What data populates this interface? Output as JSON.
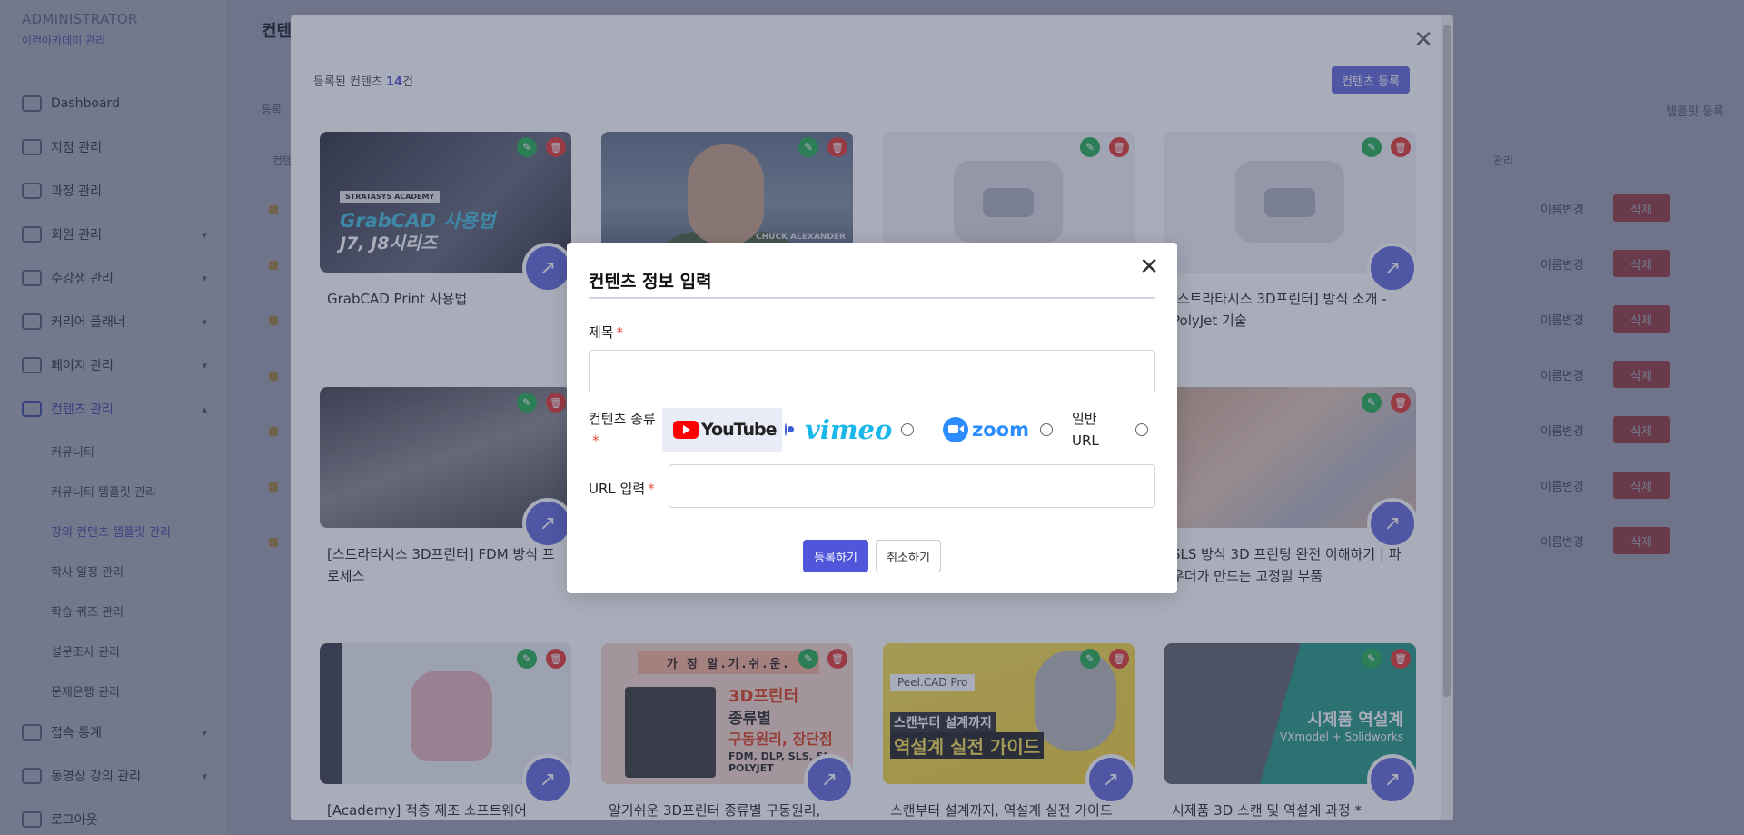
{
  "sidebar": {
    "admin_title": "ADMINISTRATOR",
    "admin_sub": "이런아카데미 관리",
    "items": [
      {
        "label": "Dashboard",
        "chevron": ""
      },
      {
        "label": "지점 관리",
        "chevron": ""
      },
      {
        "label": "과정 관리",
        "chevron": ""
      },
      {
        "label": "회원 관리",
        "chevron": "▾"
      },
      {
        "label": "수강생 관리",
        "chevron": "▾"
      },
      {
        "label": "커리어 플래너",
        "chevron": "▾"
      },
      {
        "label": "페이지 관리",
        "chevron": "▾"
      },
      {
        "label": "컨텐츠 관리",
        "chevron": "▴"
      }
    ],
    "sub_items": [
      "커뮤니티",
      "커뮤니티 템플릿 관리",
      "강의 컨텐츠 템플릿 관리",
      "학사 일정 관리",
      "학습 퀴즈 관리",
      "설문조사 관리",
      "문제은행 관리"
    ],
    "bottom_items": [
      {
        "label": "접속 통계",
        "chevron": "▾"
      },
      {
        "label": "동영상 강의 관리",
        "chevron": "▾"
      },
      {
        "label": "로그아웃",
        "chevron": ""
      }
    ]
  },
  "main": {
    "page_title": "컨텐",
    "small_left": "등록",
    "col_left": "컨텐",
    "template_register": "템플릿 등록",
    "col_manage": "관리",
    "row_rename": "이름변경",
    "row_delete": "삭제"
  },
  "content_modal": {
    "count_prefix": "등록된 컨텐츠 ",
    "count": "14",
    "count_suffix": "건",
    "add_button": "컨텐츠 등록",
    "cards": [
      {
        "title": "GrabCAD Print 사용법",
        "tag": "STRATASYS ACADEMY",
        "line1": "GrabCAD 사용법",
        "line2": "J7, J8시리즈"
      },
      {
        "title": "",
        "name": "CHUCK ALEXANDER"
      },
      {
        "title": ""
      },
      {
        "title": "[스트라타시스 3D프린터] 방식 소개 - PolyJet 기술"
      },
      {
        "title": "[스트라타시스 3D프린터] FDM 방식 프로세스"
      },
      {
        "title": "SLS 방식 3D 프린팅 완전 이해하기 | 파우더가 만드는 고정밀 부품"
      },
      {
        "title": "[Academy] 적층 제조 소프트웨어"
      },
      {
        "title": "알기쉬운 3D프린터 종류별 구동원리,",
        "top": "가 장  알.기.쉬.운.",
        "a": "3D프린터",
        "b": "종류별",
        "c": "구동원리, 장단점",
        "d": "FDM, DLP, SLS, SL POLYJET"
      },
      {
        "title": "스캔부터 설계까지, 역설계 실전 가이드",
        "brand": "Peel.CAD Pro",
        "l1": "스캔부터 설계까지",
        "l2": "역설계 실전 가이드"
      },
      {
        "title": "시제품 3D 스캔 및 역설계 과정 *",
        "l1": "시제품 역설계",
        "l2": "VXmodel + Solidworks"
      }
    ]
  },
  "form_modal": {
    "title": "컨텐츠 정보 입력",
    "title_label": "제목",
    "title_value": "",
    "type_label": "컨텐츠 종류",
    "type_options": [
      {
        "name": "YouTube",
        "selected": true
      },
      {
        "name": "vimeo",
        "selected": false
      },
      {
        "name": "zoom",
        "selected": false
      },
      {
        "name": "일반 URL",
        "selected": false
      }
    ],
    "url_label": "URL 입력",
    "url_value": "",
    "submit_label": "등록하기",
    "cancel_label": "취소하기"
  },
  "colors": {
    "accent": "#5b63d6",
    "primary_button": "#4f56d9",
    "edit": "#2fb25a",
    "delete": "#e3433e"
  },
  "icons": {
    "close": "close-icon",
    "edit": "pencil-icon",
    "delete": "trash-icon",
    "open": "arrow-up-right-icon"
  }
}
